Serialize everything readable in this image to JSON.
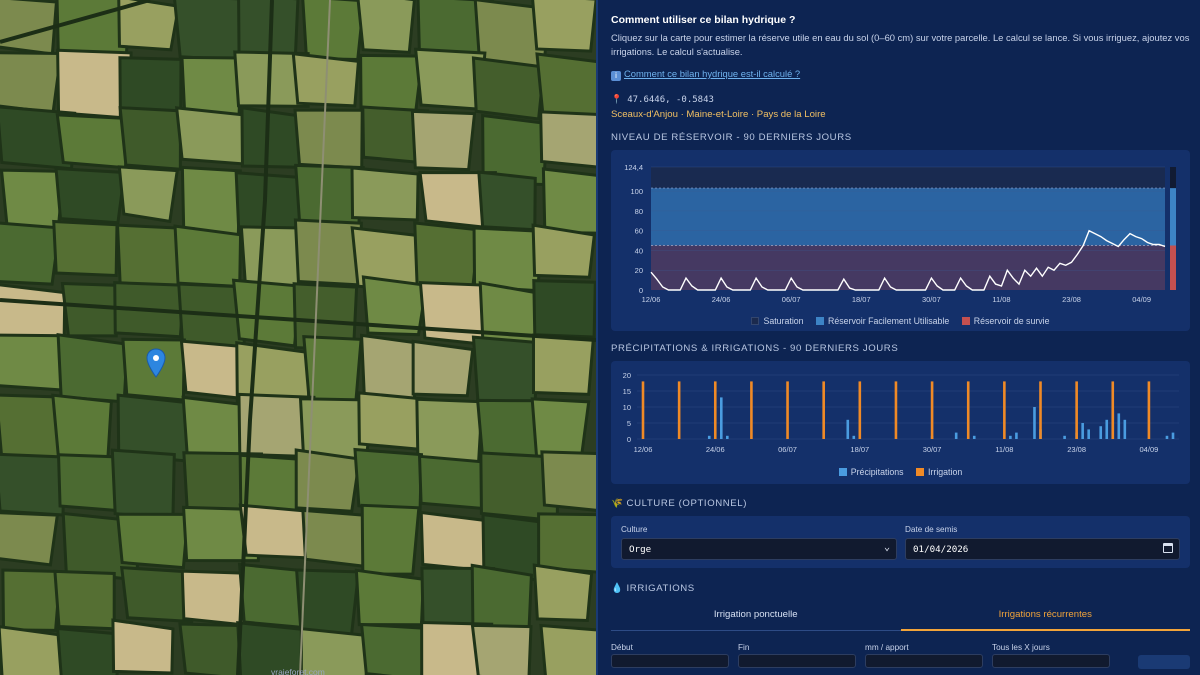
{
  "help": {
    "title": "Comment utiliser ce bilan hydrique ?",
    "text": "Cliquez sur la carte pour estimer la réserve utile en eau du sol (0–60 cm) sur votre parcelle. Le calcul se lance. Si vous irriguez, ajoutez vos irrigations. Le calcul s'actualise.",
    "link": "Comment ce bilan hydrique est-il calculé ?",
    "link_icon": "info-icon"
  },
  "location": {
    "coords": "47.6446, -0.5843",
    "place": "Sceaux-d'Anjou · Maine-et-Loire · Pays de la Loire",
    "pin_icon": "map-pin-icon"
  },
  "sections": {
    "reservoir": "NIVEAU DE RÉSERVOIR - 90 DERNIERS JOURS",
    "precip": "PRÉCIPITATIONS & IRRIGATIONS - 90 DERNIERS JOURS",
    "culture": "CULTURE (OPTIONNEL)",
    "irrigations": "IRRIGATIONS"
  },
  "culture": {
    "culture_label": "Culture",
    "culture_value": "Orge",
    "sowing_label": "Date de semis",
    "sowing_value": "01/04/2026"
  },
  "tabs": [
    "Irrigation ponctuelle",
    "Irrigations récurrentes"
  ],
  "recurrent_fields": [
    "Début",
    "Fin",
    "mm / apport",
    "Tous les X jours"
  ],
  "watermark": "vraieforet.com",
  "colors": {
    "saturation": "#1b2a4e",
    "ru": "#3d84c6",
    "survival": "#c45050",
    "precip": "#4a9ce0",
    "irrigation": "#f08a26",
    "accent": "#f2a43a"
  },
  "chart_data": [
    {
      "type": "area",
      "title": "NIVEAU DE RÉSERVOIR - 90 DERNIERS JOURS",
      "ylim": [
        0,
        124.4
      ],
      "y_ticks": [
        "0",
        "20",
        "40",
        "60",
        "80",
        "100",
        "124,4"
      ],
      "x_ticks": [
        "12/06",
        "24/06",
        "06/07",
        "18/07",
        "30/07",
        "11/08",
        "23/08",
        "04/09"
      ],
      "zones": [
        {
          "name": "Saturation",
          "from": 103,
          "to": 124.4
        },
        {
          "name": "Réservoir Facilement Utilisable",
          "from": 45,
          "to": 103
        },
        {
          "name": "Réservoir de survie",
          "from": 0,
          "to": 45
        }
      ],
      "series": [
        {
          "name": "",
          "x": [
            "12/06",
            "13/06",
            "14/06",
            "15/06",
            "16/06",
            "17/06",
            "18/06",
            "19/06",
            "20/06",
            "21/06",
            "22/06",
            "23/06",
            "24/06",
            "25/06",
            "26/06",
            "27/06",
            "28/06",
            "29/06",
            "30/06",
            "01/07",
            "02/07",
            "03/07",
            "04/07",
            "05/07",
            "06/07",
            "07/07",
            "08/07",
            "09/07",
            "10/07",
            "11/07",
            "12/07",
            "13/07",
            "14/07",
            "15/07",
            "16/07",
            "17/07",
            "18/07",
            "19/07",
            "20/07",
            "21/07",
            "22/07",
            "23/07",
            "24/07",
            "25/07",
            "26/07",
            "27/07",
            "28/07",
            "29/07",
            "30/07",
            "31/07",
            "01/08",
            "02/08",
            "03/08",
            "04/08",
            "05/08",
            "06/08",
            "07/08",
            "08/08",
            "09/08",
            "10/08",
            "11/08",
            "12/08",
            "13/08",
            "14/08",
            "15/08",
            "16/08",
            "17/08",
            "18/08",
            "19/08",
            "20/08",
            "21/08",
            "22/08",
            "23/08",
            "24/08",
            "25/08",
            "26/08",
            "27/08",
            "28/08",
            "29/08",
            "30/08",
            "31/08",
            "01/09",
            "02/09",
            "03/09",
            "04/09",
            "05/09",
            "06/09",
            "07/09",
            "08/09"
          ],
          "values": [
            18,
            11,
            3,
            0,
            0,
            0,
            12,
            4,
            0,
            0,
            0,
            0,
            12,
            3,
            0,
            0,
            0,
            0,
            12,
            3,
            0,
            0,
            0,
            0,
            12,
            3,
            0,
            0,
            0,
            0,
            0,
            0,
            0,
            11,
            2,
            0,
            0,
            0,
            0,
            0,
            12,
            3,
            0,
            0,
            0,
            0,
            0,
            0,
            12,
            4,
            0,
            0,
            0,
            12,
            4,
            0,
            0,
            0,
            14,
            6,
            4,
            20,
            12,
            6,
            20,
            14,
            22,
            14,
            23,
            20,
            27,
            25,
            28,
            36,
            45,
            60,
            57,
            54,
            50,
            47,
            44,
            51,
            57,
            54,
            52,
            48,
            46,
            46,
            44
          ]
        }
      ]
    },
    {
      "type": "bar",
      "title": "PRÉCIPITATIONS & IRRIGATIONS - 90 DERNIERS JOURS",
      "ylim": [
        0,
        20
      ],
      "y_ticks": [
        "0",
        "5",
        "10",
        "15",
        "20"
      ],
      "x_ticks": [
        "12/06",
        "24/06",
        "06/07",
        "18/07",
        "30/07",
        "11/08",
        "23/08",
        "04/09"
      ],
      "series": [
        {
          "name": "Précipitations",
          "points": [
            {
              "x": "23/06",
              "value": 1
            },
            {
              "x": "25/06",
              "value": 13
            },
            {
              "x": "26/06",
              "value": 1
            },
            {
              "x": "16/07",
              "value": 6
            },
            {
              "x": "17/07",
              "value": 1
            },
            {
              "x": "30/07",
              "value": 1
            },
            {
              "x": "03/08",
              "value": 2
            },
            {
              "x": "06/08",
              "value": 1
            },
            {
              "x": "12/08",
              "value": 1
            },
            {
              "x": "13/08",
              "value": 2
            },
            {
              "x": "16/08",
              "value": 10
            },
            {
              "x": "17/08",
              "value": 3
            },
            {
              "x": "21/08",
              "value": 1
            },
            {
              "x": "23/08",
              "value": 2
            },
            {
              "x": "24/08",
              "value": 5
            },
            {
              "x": "25/08",
              "value": 3
            },
            {
              "x": "27/08",
              "value": 4
            },
            {
              "x": "28/08",
              "value": 6
            },
            {
              "x": "29/08",
              "value": 9
            },
            {
              "x": "30/08",
              "value": 8
            },
            {
              "x": "31/08",
              "value": 6
            },
            {
              "x": "07/09",
              "value": 1
            },
            {
              "x": "08/09",
              "value": 2
            }
          ]
        },
        {
          "name": "Irrigation",
          "points": [
            {
              "x": "12/06",
              "value": 18
            },
            {
              "x": "18/06",
              "value": 18
            },
            {
              "x": "24/06",
              "value": 18
            },
            {
              "x": "30/06",
              "value": 18
            },
            {
              "x": "06/07",
              "value": 18
            },
            {
              "x": "12/07",
              "value": 18
            },
            {
              "x": "18/07",
              "value": 18
            },
            {
              "x": "24/07",
              "value": 18
            },
            {
              "x": "30/07",
              "value": 18
            },
            {
              "x": "05/08",
              "value": 18
            },
            {
              "x": "11/08",
              "value": 18
            },
            {
              "x": "17/08",
              "value": 18
            },
            {
              "x": "23/08",
              "value": 18
            },
            {
              "x": "29/08",
              "value": 18
            },
            {
              "x": "04/09",
              "value": 18
            }
          ]
        }
      ]
    }
  ]
}
